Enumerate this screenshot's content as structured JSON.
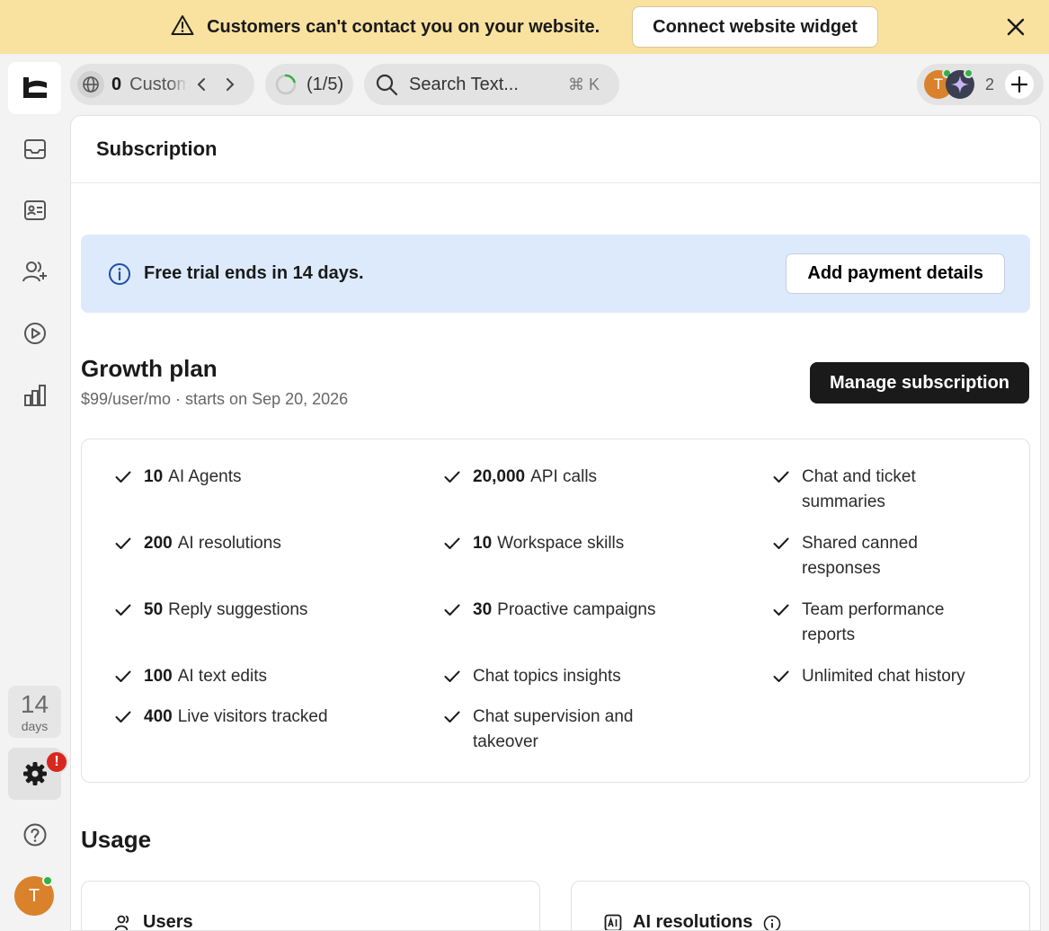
{
  "banner": {
    "message": "Customers can't contact you on your website.",
    "button": "Connect website widget"
  },
  "sidebar": {
    "trial_days": "14",
    "trial_days_label": "days",
    "settings_badge": "!",
    "user_initial": "T"
  },
  "toolbar": {
    "customers_count": "0",
    "customers_label": "Customers",
    "progress": "(1/5)",
    "search_placeholder": "Search Text...",
    "search_shortcut": "⌘ K",
    "team_initial": "T",
    "team_count": "2"
  },
  "page": {
    "title": "Subscription",
    "trial_message": "Free trial ends in 14 days.",
    "trial_button": "Add payment details",
    "plan_name": "Growth plan",
    "plan_subtitle": "$99/user/mo · starts on Sep 20, 2026",
    "manage_button": "Manage subscription",
    "usage_title": "Usage"
  },
  "features": [
    {
      "value": "10",
      "label": "AI Agents"
    },
    {
      "value": "200",
      "label": "AI resolutions"
    },
    {
      "value": "50",
      "label": "Reply suggestions"
    },
    {
      "value": "100",
      "label": "AI text edits"
    },
    {
      "value": "400",
      "label": "Live visitors tracked"
    },
    {
      "value": "20,000",
      "label": "API calls"
    },
    {
      "value": "10",
      "label": "Workspace skills"
    },
    {
      "value": "30",
      "label": "Proactive campaigns"
    },
    {
      "value": "",
      "label": "Chat topics insights"
    },
    {
      "value": "",
      "label": "Chat supervision and takeover"
    },
    {
      "value": "",
      "label": "Chat and ticket summaries"
    },
    {
      "value": "",
      "label": "Shared canned responses"
    },
    {
      "value": "",
      "label": "Team performance reports"
    },
    {
      "value": "",
      "label": "Unlimited chat history"
    }
  ],
  "usage_cards": [
    {
      "label": "Users",
      "icon": "users-icon"
    },
    {
      "label": "AI resolutions",
      "icon": "ai-icon"
    }
  ],
  "colors": {
    "banner_bg": "#f9e1a0",
    "trial_bg": "#dceafb",
    "accent_dark": "#1a1a1a",
    "badge_red": "#d6281f",
    "avatar_orange": "#d9822b",
    "online_green": "#2fb344"
  }
}
